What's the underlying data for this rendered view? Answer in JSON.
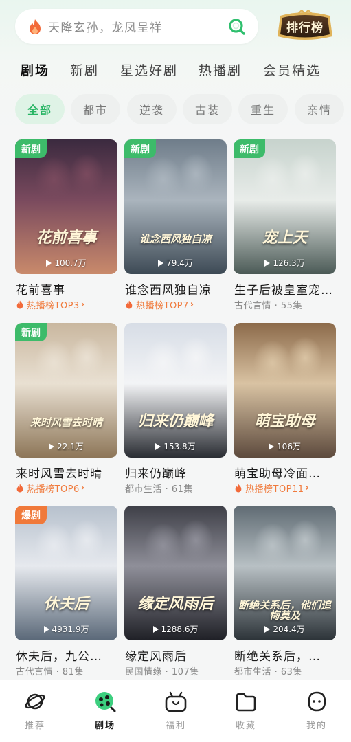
{
  "search": {
    "placeholder": "天降玄孙，龙凤呈祥",
    "rank_label": "排行榜"
  },
  "tabs": [
    {
      "label": "剧场",
      "active": true
    },
    {
      "label": "新剧",
      "active": false
    },
    {
      "label": "星选好剧",
      "active": false
    },
    {
      "label": "热播剧",
      "active": false
    },
    {
      "label": "会员精选",
      "active": false
    }
  ],
  "chips": [
    {
      "label": "全部",
      "active": true
    },
    {
      "label": "都市",
      "active": false
    },
    {
      "label": "逆袭",
      "active": false
    },
    {
      "label": "古装",
      "active": false
    },
    {
      "label": "重生",
      "active": false
    },
    {
      "label": "亲情",
      "active": false
    }
  ],
  "cards": [
    {
      "badge": "新剧",
      "badge_type": "new",
      "poster_title": "花前喜事",
      "views": "100.7万",
      "title": "花前喜事",
      "sub": "热播榜TOP3",
      "sub_type": "hot",
      "colors": [
        "#3b2a3f",
        "#7a4a5e",
        "#c98a6b"
      ]
    },
    {
      "badge": "新剧",
      "badge_type": "new",
      "poster_title": "谁念西风独自凉",
      "views": "79.4万",
      "title": "谁念西风独自凉",
      "sub": "热播榜TOP7",
      "sub_type": "hot",
      "colors": [
        "#6f7d8a",
        "#aab4bd",
        "#3d4a55"
      ]
    },
    {
      "badge": "新剧",
      "badge_type": "new",
      "poster_title": "宠上天",
      "views": "126.3万",
      "title": "生子后被皇室宠上天",
      "sub": "古代言情 · 55集",
      "sub_type": "normal",
      "colors": [
        "#c7d3cd",
        "#e8ece9",
        "#4b5a56"
      ]
    },
    {
      "badge": "新剧",
      "badge_type": "new",
      "poster_title": "来时风雪去时晴",
      "views": "22.1万",
      "title": "来时风雪去时晴",
      "sub": "热播榜TOP6",
      "sub_type": "hot",
      "colors": [
        "#c9b79f",
        "#e9e0d2",
        "#8d7658"
      ]
    },
    {
      "badge": "",
      "badge_type": "none",
      "poster_title": "归来仍巅峰",
      "views": "153.8万",
      "title": "归来仍巅峰",
      "sub": "都市生活 · 61集",
      "sub_type": "normal",
      "colors": [
        "#d7dde6",
        "#f3f4f6",
        "#2a2d33"
      ]
    },
    {
      "badge": "",
      "badge_type": "none",
      "poster_title": "萌宝助母",
      "views": "106万",
      "title": "萌宝助母冷面…",
      "sub": "热播榜TOP11",
      "sub_type": "hot",
      "colors": [
        "#8c6a4a",
        "#d9c3a3",
        "#5d4a3d"
      ]
    },
    {
      "badge": "爆剧",
      "badge_type": "hot",
      "poster_title": "休夫后",
      "views": "4931.9万",
      "title": "休夫后，九公…",
      "sub": "古代言情 · 81集",
      "sub_type": "normal",
      "colors": [
        "#b7c1cd",
        "#e6e9ee",
        "#5a6878"
      ]
    },
    {
      "badge": "",
      "badge_type": "none",
      "poster_title": "缘定风雨后",
      "views": "1288.6万",
      "title": "缘定风雨后",
      "sub": "民国情缘 · 107集",
      "sub_type": "normal",
      "colors": [
        "#3e3f47",
        "#8f8f99",
        "#1f2026"
      ]
    },
    {
      "badge": "",
      "badge_type": "none",
      "poster_title": "断绝关系后，他们追悔莫及",
      "views": "204.4万",
      "title": "断绝关系后，…",
      "sub": "都市生活 · 63集",
      "sub_type": "normal",
      "colors": [
        "#5f6b73",
        "#b8c0c4",
        "#2c3338"
      ]
    }
  ],
  "nav": [
    {
      "label": "推荐",
      "icon": "planet-icon",
      "active": false
    },
    {
      "label": "剧场",
      "icon": "theater-icon",
      "active": true
    },
    {
      "label": "福利",
      "icon": "gift-icon",
      "active": false
    },
    {
      "label": "收藏",
      "icon": "folder-icon",
      "active": false
    },
    {
      "label": "我的",
      "icon": "profile-icon",
      "active": false
    }
  ],
  "colors": {
    "accent": "#27b463",
    "hot": "#f07a3c",
    "new_badge": "#3dbb6a"
  }
}
